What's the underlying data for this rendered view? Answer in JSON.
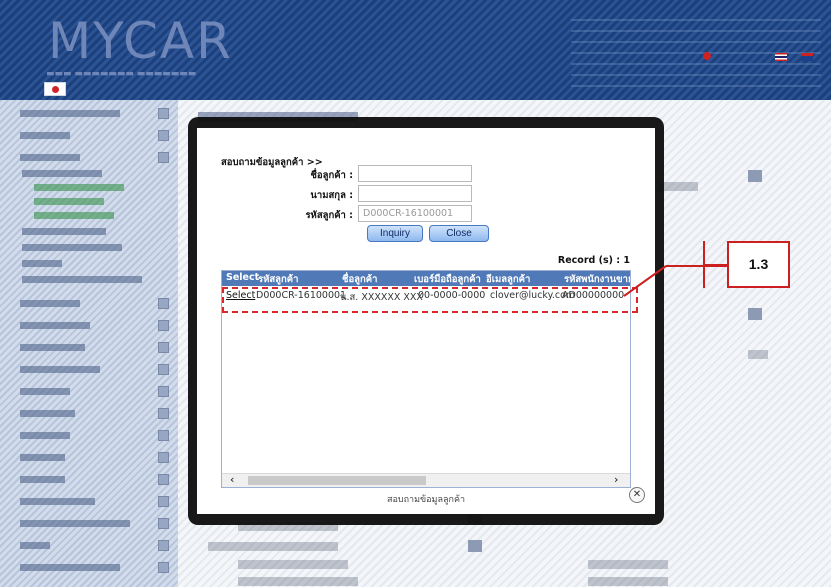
{
  "header": {
    "logo": "MYCAR"
  },
  "dialog": {
    "title": "สอบถามข้อมูลลูกค้า >>",
    "fields": {
      "first_name_label": "ชื่อลูกค้า :",
      "first_name_value": "",
      "last_name_label": "นามสกุล :",
      "last_name_value": "",
      "customer_id_label": "รหัสลูกค้า :",
      "customer_id_value": "D000CR-16100001"
    },
    "buttons": {
      "inquiry": "Inquiry",
      "close": "Close"
    },
    "record_count": "Record (s) : 1",
    "columns": [
      "Select",
      "รหัสลูกค้า",
      "ชื่อลูกค้า",
      "เบอร์มือถือลูกค้า",
      "อีเมลลูกค้า",
      "รหัสพนักงานขาย"
    ],
    "rows": [
      {
        "select": "Select",
        "customer_id": "D000CR-16100001",
        "name": "น.ส. XXXXXX XXX",
        "mobile": "00-0000-0000",
        "email": "clover@lucky.com",
        "sales_id": "AD00000000"
      }
    ],
    "footer": "สอบถามข้อมูลลูกค้า",
    "close_icon": "x-icon"
  },
  "annotation": {
    "callout": "1.3",
    "color": "#cc1f1f"
  }
}
